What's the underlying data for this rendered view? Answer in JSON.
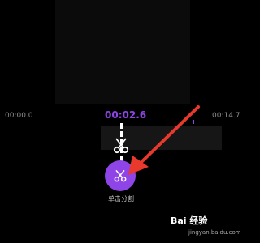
{
  "timeline": {
    "start_time": "00:00.0",
    "current_time": "00:02.6",
    "end_time": "00:14.7"
  },
  "split_button": {
    "label": "单击分割",
    "icon": "scissors-icon"
  },
  "split_marker": {
    "icon": "scissors-icon"
  },
  "annotation": {
    "arrow_color": "#e8392c"
  },
  "watermark": {
    "brand": "Bai 经验",
    "url": "jingyan.baidu.com"
  },
  "colors": {
    "accent": "#8e44e6",
    "background": "#000000"
  }
}
